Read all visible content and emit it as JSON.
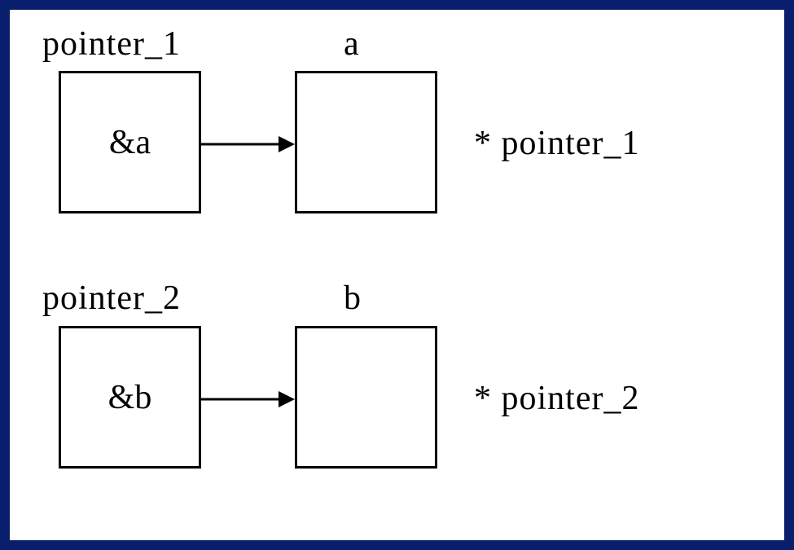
{
  "row1": {
    "pointer_label": "pointer_1",
    "var_label": "a",
    "box_content": "&a",
    "deref_label": "* pointer_1"
  },
  "row2": {
    "pointer_label": "pointer_2",
    "var_label": "b",
    "box_content": "&b",
    "deref_label": "* pointer_2"
  }
}
